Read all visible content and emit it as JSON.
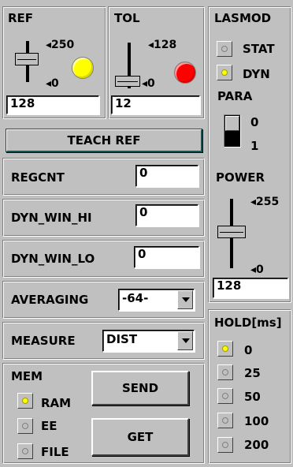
{
  "ref": {
    "title": "REF",
    "max_label": "◂250",
    "min_label": "◂0",
    "value": "128",
    "indicator_color": "#ffff00"
  },
  "tol": {
    "title": "TOL",
    "max_label": "◂128",
    "min_label": "◂0",
    "value": "12",
    "indicator_color": "#ff0000"
  },
  "teach_ref_label": "TEACH REF",
  "regcnt": {
    "label": "REGCNT",
    "value": "0"
  },
  "dyn_win_hi": {
    "label": "DYN_WIN_HI",
    "value": "0"
  },
  "dyn_win_lo": {
    "label": "DYN_WIN_LO",
    "value": "0"
  },
  "averaging": {
    "label": "AVERAGING",
    "selected": "-64-"
  },
  "measure": {
    "label": "MEASURE",
    "selected": "DIST"
  },
  "mem": {
    "title": "MEM",
    "options": [
      {
        "label": "RAM",
        "selected": true
      },
      {
        "label": "EE",
        "selected": false
      },
      {
        "label": "FILE",
        "selected": false
      }
    ],
    "send_label": "SEND",
    "get_label": "GET"
  },
  "lasmod": {
    "title": "LASMOD",
    "options": [
      {
        "label": "STAT",
        "selected": false
      },
      {
        "label": "DYN",
        "selected": true
      }
    ]
  },
  "para": {
    "title": "PARA",
    "label_0": "0",
    "label_1": "1",
    "value": 0
  },
  "power": {
    "title": "POWER",
    "max_label": "◂255",
    "min_label": "◂0",
    "value": "128"
  },
  "hold": {
    "title": "HOLD[ms]",
    "options": [
      {
        "label": "0",
        "selected": true
      },
      {
        "label": "25",
        "selected": false
      },
      {
        "label": "50",
        "selected": false
      },
      {
        "label": "100",
        "selected": false
      },
      {
        "label": "200",
        "selected": false
      }
    ]
  }
}
